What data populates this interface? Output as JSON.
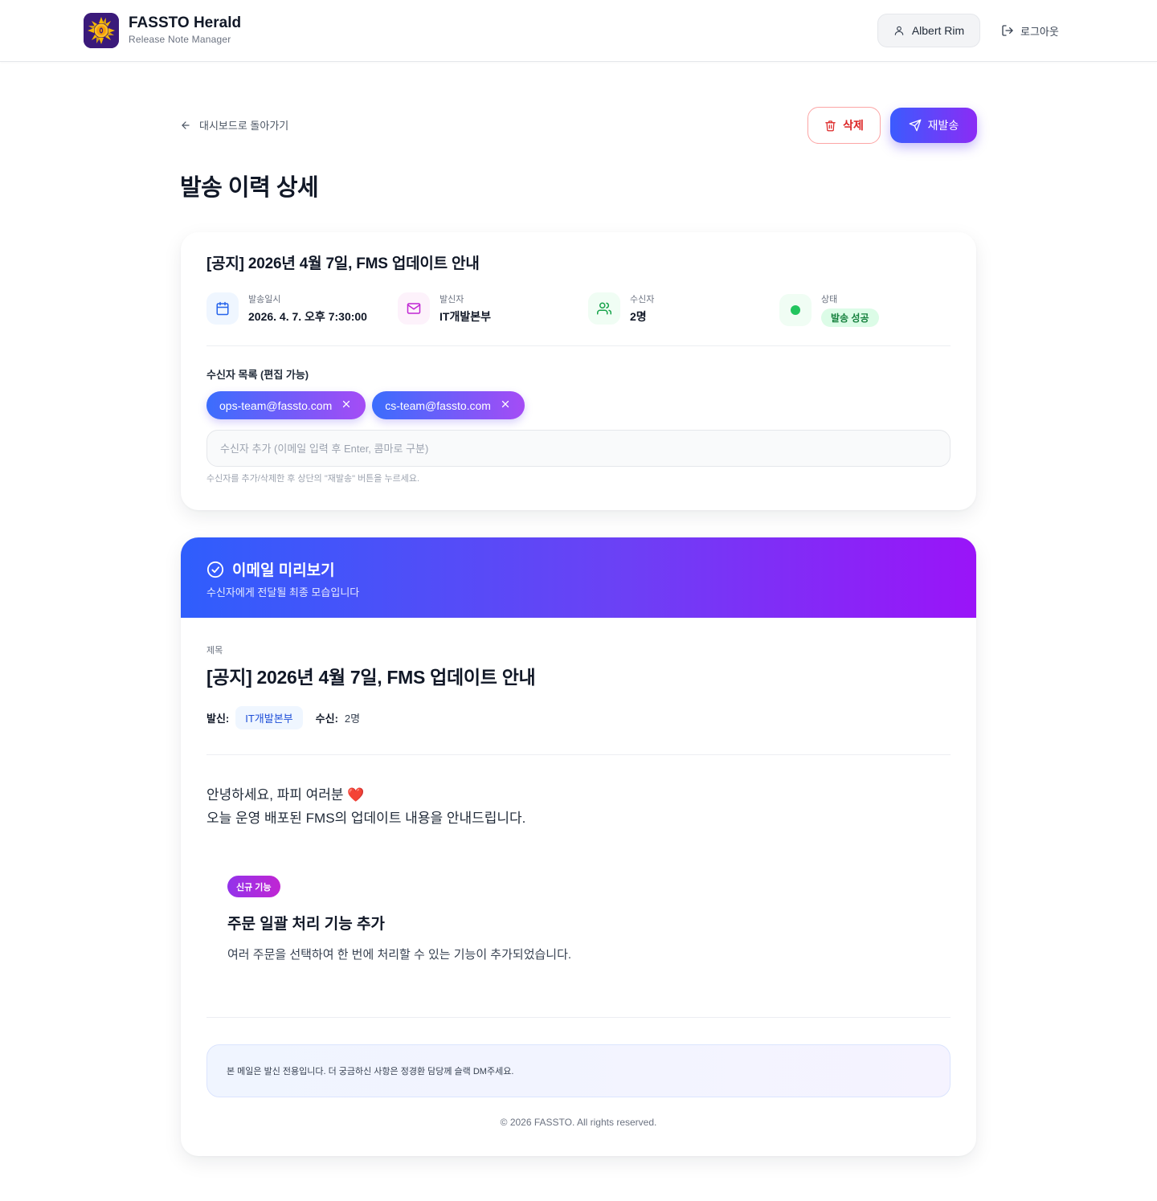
{
  "header": {
    "app_title": "FASSTO Herald",
    "app_subtitle": "Release Note Manager",
    "user_name": "Albert Rim",
    "logout_label": "로그아웃"
  },
  "toolbar": {
    "back_label": "대시보드로 돌아가기",
    "delete_label": "삭제",
    "resend_label": "재발송"
  },
  "page_title": "발송 이력 상세",
  "info": {
    "title": "[공지] 2026년 4월 7일, FMS 업데이트 안내",
    "sent_at_label": "발송일시",
    "sent_at": "2026. 4. 7. 오후 7:30:00",
    "sender_label": "발신자",
    "sender": "IT개발본부",
    "recipients_label": "수신자",
    "recipients_count": "2명",
    "status_label": "상태",
    "status": "발송 성공",
    "recipients_list_label": "수신자 목록 (편집 가능)",
    "recipients": [
      "ops-team@fassto.com",
      "cs-team@fassto.com"
    ],
    "add_placeholder": "수신자 추가 (이메일 입력 후 Enter, 콤마로 구분)",
    "hint": "수신자를 추가/삭제한 후 상단의 \"재발송\" 버튼을 누르세요."
  },
  "preview": {
    "heading": "이메일 미리보기",
    "subheading": "수신자에게 전달될 최종 모습입니다",
    "subject_label": "제목",
    "subject": "[공지] 2026년 4월 7일, FMS 업데이트 안내",
    "from_label": "발신:",
    "from_value": "IT개발본부",
    "to_label": "수신:",
    "to_value": "2명",
    "greeting": "안녕하세요, 파피 여러분",
    "greeting_emoji": "❤️",
    "intro": "오늘 운영 배포된 FMS의 업데이트 내용을 안내드립니다.",
    "feature_tag": "신규 기능",
    "feature_title": "주문 일괄 처리 기능 추가",
    "feature_desc": "여러 주문을 선택하여 한 번에 처리할 수 있는 기능이 추가되었습니다.",
    "notice": "본 메일은 발신 전용입니다. 더 궁금하신 사항은 정경환 담당께 슬랙 DM주세요.",
    "copyright": "© 2026 FASSTO. All rights reserved."
  },
  "icons": {
    "logo": "sun-logo-icon",
    "user": "user-icon",
    "logout": "logout-icon",
    "back": "arrow-left-icon",
    "delete": "trash-icon",
    "resend": "send-icon",
    "calendar": "calendar-icon",
    "mail": "mail-icon",
    "users": "users-icon",
    "status": "status-dot-icon",
    "check": "check-circle-icon",
    "remove": "close-icon"
  },
  "colors": {
    "primary_gradient_start": "#3b5bfe",
    "primary_gradient_end": "#8b2cf5",
    "danger": "#dc2626",
    "success": "#22c55e",
    "success_bg": "#dcfce7"
  }
}
